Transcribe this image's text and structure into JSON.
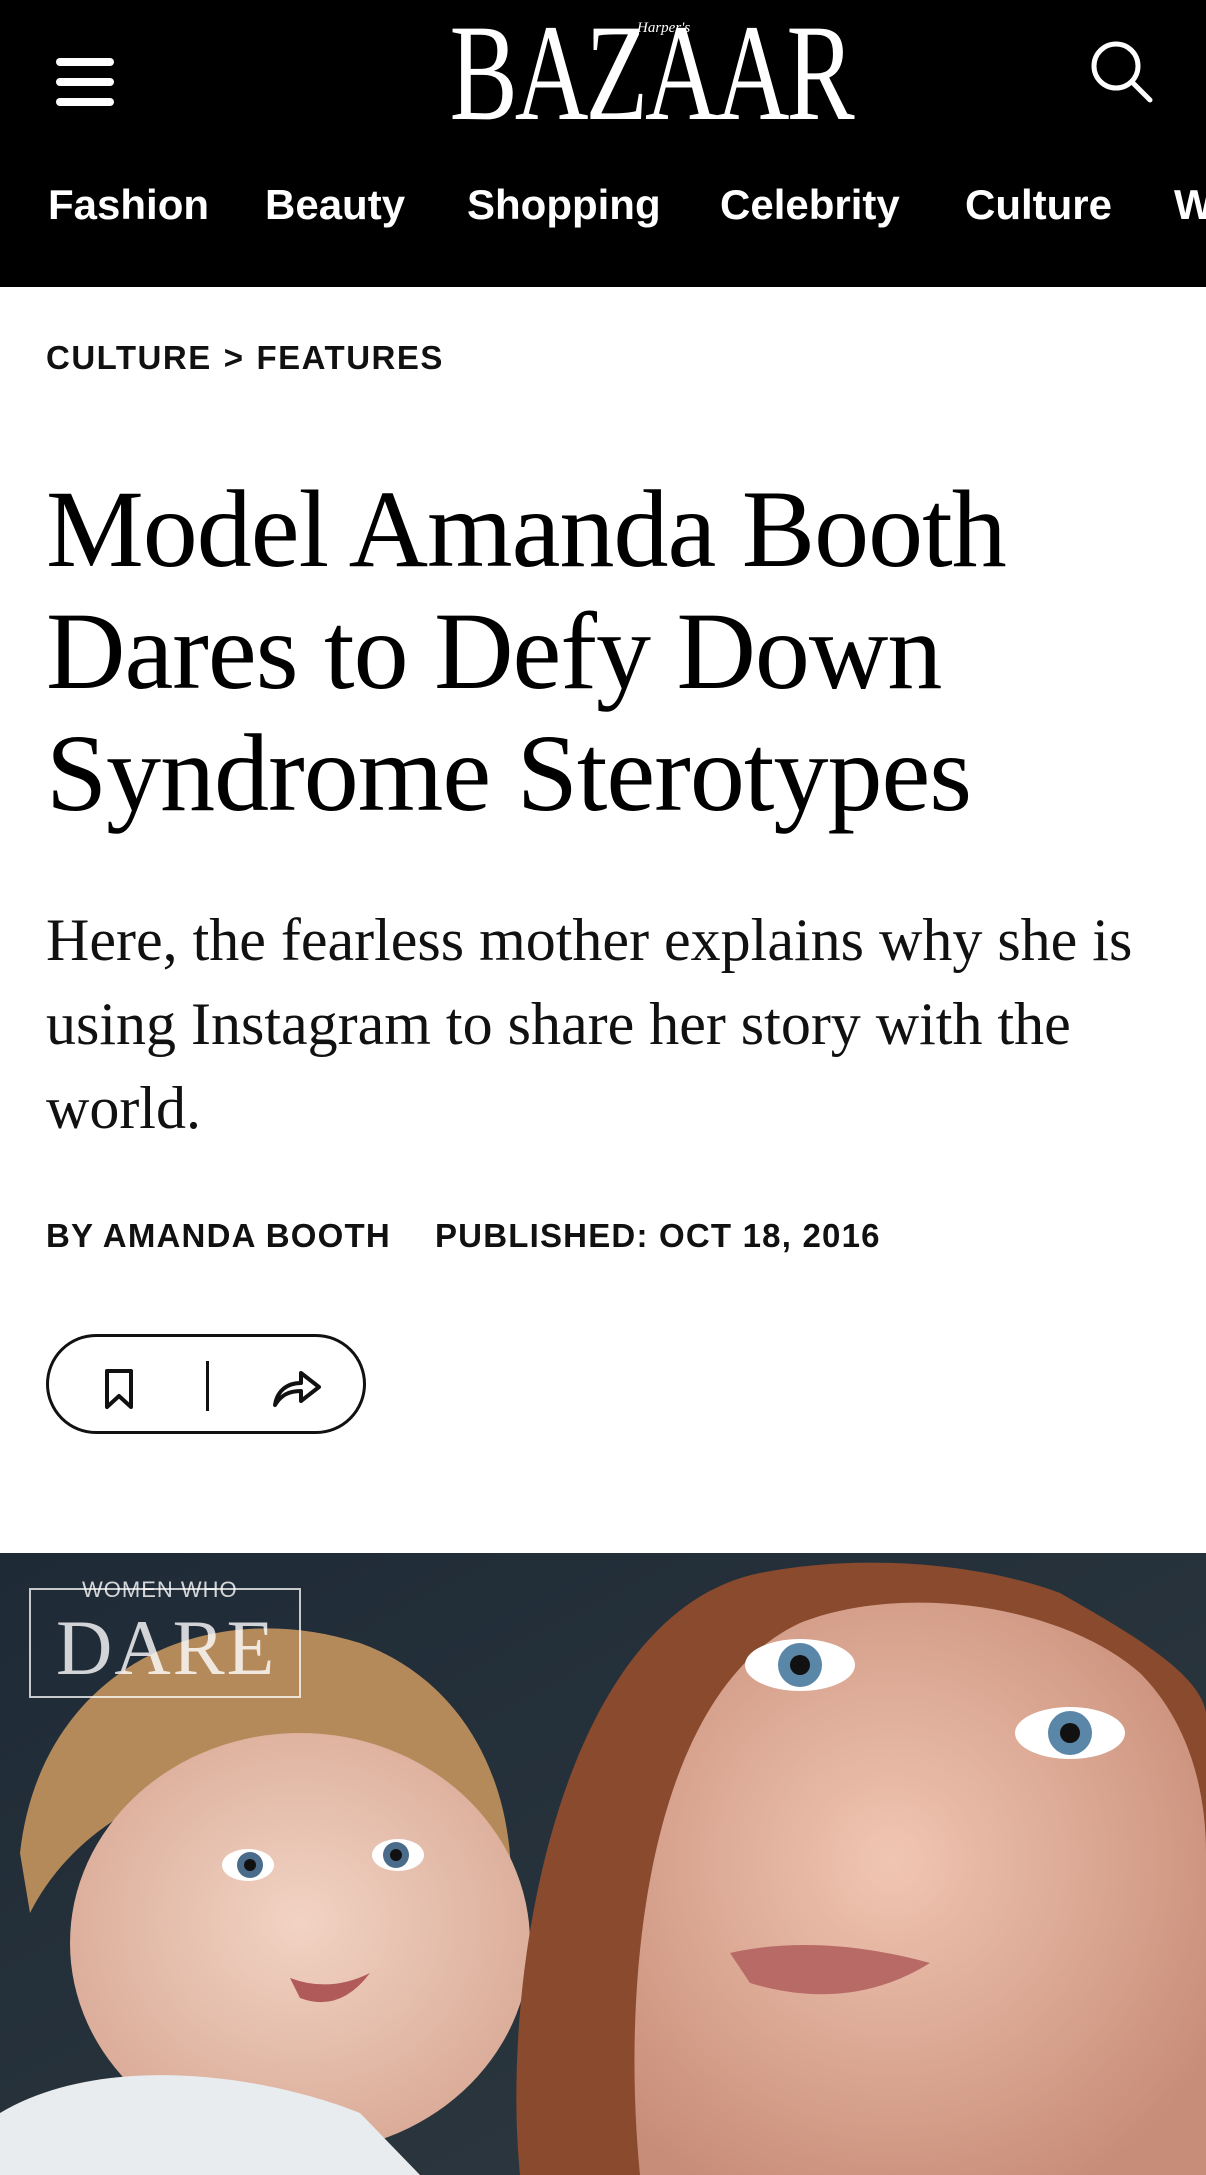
{
  "header": {
    "logo_text": "BAZAAR",
    "logo_small_text": "Harper's",
    "menu_icon": "hamburger-menu-icon",
    "search_icon": "search-icon",
    "nav": [
      {
        "label": "Fashion"
      },
      {
        "label": "Beauty"
      },
      {
        "label": "Shopping"
      },
      {
        "label": "Celebrity"
      },
      {
        "label": "Culture"
      },
      {
        "label": "W"
      }
    ]
  },
  "breadcrumb": {
    "section": "CULTURE",
    "separator": ">",
    "subsection": "FEATURES"
  },
  "article": {
    "headline": "Model Amanda Booth Dares to Defy Down Syndrome Sterotypes",
    "dek": "Here, the fearless mother explains why she is using Instagram to share her story with the world.",
    "byline": "BY AMANDA BOOTH",
    "published": "PUBLISHED: OCT 18, 2016",
    "actions": {
      "bookmark_icon": "bookmark-icon",
      "share_icon": "share-icon"
    }
  },
  "hero": {
    "overlay_small": "WOMEN WHO",
    "overlay_big": "DARE"
  },
  "colors": {
    "header_bg": "#000000",
    "text": "#111111",
    "page_bg": "#ffffff"
  }
}
